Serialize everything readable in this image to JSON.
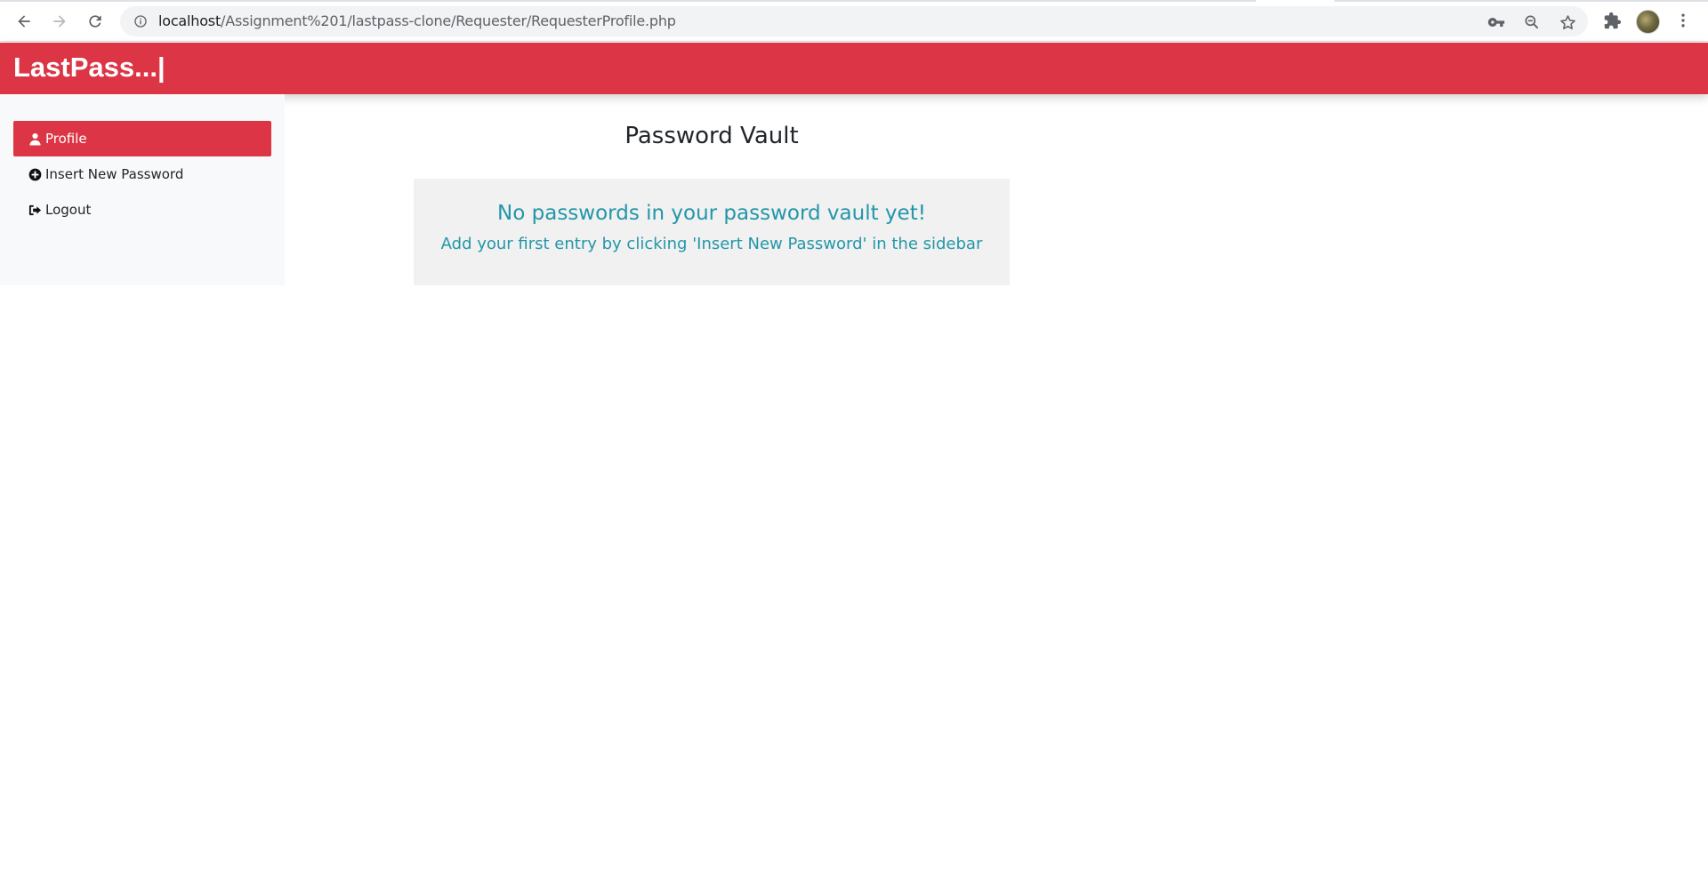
{
  "browser": {
    "url_host": "localhost",
    "url_path": "/Assignment%201/lastpass-clone/Requester/RequesterProfile.php",
    "icons": [
      "back-icon",
      "forward-icon",
      "reload-icon",
      "site-info-icon",
      "key-icon",
      "zoom-out-icon",
      "bookmark-star-icon",
      "extensions-icon",
      "profile-avatar",
      "menu-kebab-icon"
    ]
  },
  "header": {
    "brand": "LastPass...|"
  },
  "sidebar": {
    "items": [
      {
        "label": "Profile",
        "icon": "user-icon",
        "active": true
      },
      {
        "label": "Insert New Password",
        "icon": "plus-circle-icon",
        "active": false
      },
      {
        "label": "Logout",
        "icon": "sign-out-icon",
        "active": false
      }
    ]
  },
  "main": {
    "title": "Password Vault",
    "empty_message": "No passwords in your password vault yet!",
    "empty_hint": "Add your first entry by clicking 'Insert New Password' in the sidebar"
  },
  "colors": {
    "brand_red": "#dc3545",
    "info_teal": "#2396a8",
    "sidebar_bg": "#f8f9fa",
    "empty_box_bg": "#f1f1f1"
  }
}
